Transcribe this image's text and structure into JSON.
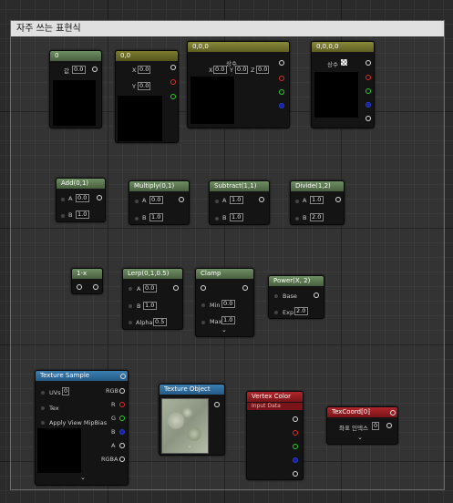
{
  "comment": {
    "title": "자주 쓰는 표현식"
  },
  "constant1": {
    "title": "0",
    "value_label": "값",
    "value": "0.0"
  },
  "constant2": {
    "title": "0,0",
    "x_label": "X",
    "x": "0.0",
    "y_label": "Y",
    "y": "0.0"
  },
  "constant3": {
    "title": "0,0,0",
    "const_label": "상수",
    "x_label": "X",
    "x": "0.0",
    "y_label": "Y",
    "y": "0.0",
    "z_label": "Z",
    "z": "0.0"
  },
  "constant4": {
    "title": "0,0,0,0",
    "const_label": "상수"
  },
  "add": {
    "title": "Add(0,1)",
    "a_label": "A",
    "a": "0.0",
    "b_label": "B",
    "b": "1.0"
  },
  "multiply": {
    "title": "Multiply(0,1)",
    "a_label": "A",
    "a": "0.0",
    "b_label": "B",
    "b": "1.0"
  },
  "subtract": {
    "title": "Subtract(1,1)",
    "a_label": "A",
    "a": "1.0",
    "b_label": "B",
    "b": "1.0"
  },
  "divide": {
    "title": "Divide(1,2)",
    "a_label": "A",
    "a": "1.0",
    "b_label": "B",
    "b": "2.0"
  },
  "oneminus": {
    "title": "1-x"
  },
  "lerp": {
    "title": "Lerp(0,1,0.5)",
    "a_label": "A",
    "a": "0.0",
    "b_label": "B",
    "b": "1.0",
    "alpha_label": "Alpha",
    "alpha": "0.5"
  },
  "clamp": {
    "title": "Clamp",
    "min_label": "Min",
    "min": "0.0",
    "max_label": "Max",
    "max": "1.0"
  },
  "power": {
    "title": "Power(X, 2)",
    "base_label": "Base",
    "exp_label": "Exp",
    "exp": "2.0"
  },
  "texsample": {
    "title": "Texture Sample",
    "uvs_label": "UVs",
    "uvs": "0",
    "tex_label": "Tex",
    "mip_label": "Apply View MipBias",
    "out_rgb": "RGB",
    "out_r": "R",
    "out_g": "G",
    "out_b": "B",
    "out_a": "A",
    "out_rgba": "RGBA"
  },
  "texobject": {
    "title": "Texture Object"
  },
  "vertexcolor": {
    "title": "Vertex Color",
    "subtitle": "Input Data"
  },
  "texcoord": {
    "title": "TexCoord[0]",
    "index_label": "좌표 인덱스",
    "index": "0"
  },
  "colors": {
    "header_constant": "#8a8a3a",
    "header_math": "#5e7a55",
    "header_texture": "#3c7fb1",
    "header_vertex": "#b0272d"
  }
}
